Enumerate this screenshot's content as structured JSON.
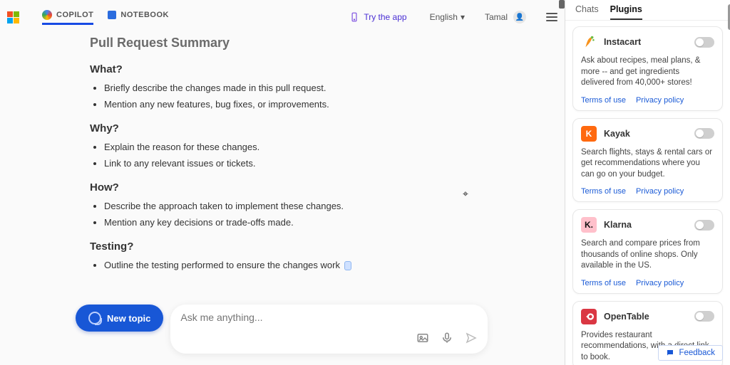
{
  "topbar": {
    "mode_copilot": "COPILOT",
    "mode_notebook": "NOTEBOOK",
    "try_app": "Try the app",
    "lang": "English",
    "user": "Tamal"
  },
  "doc": {
    "title": "Pull Request Summary",
    "sections": [
      {
        "heading": "What?",
        "items": [
          "Briefly describe the changes made in this pull request.",
          "Mention any new features, bug fixes, or improvements."
        ]
      },
      {
        "heading": "Why?",
        "items": [
          "Explain the reason for these changes.",
          "Link to any relevant issues or tickets."
        ]
      },
      {
        "heading": "How?",
        "items": [
          "Describe the approach taken to implement these changes.",
          "Mention any key decisions or trade-offs made."
        ]
      },
      {
        "heading": "Testing?",
        "items": [
          "Outline the testing performed to ensure the changes work"
        ]
      }
    ]
  },
  "composer": {
    "new_topic": "New topic",
    "placeholder": "Ask me anything..."
  },
  "side": {
    "tab_chats": "Chats",
    "tab_plugins": "Plugins",
    "tos": "Terms of use",
    "privacy": "Privacy policy",
    "plugins": [
      {
        "name": "Instacart",
        "desc": "Ask about recipes, meal plans, & more -- and get ingredients delivered from 40,000+ stores!"
      },
      {
        "name": "Kayak",
        "desc": "Search flights, stays & rental cars or get recommendations where you can go on your budget."
      },
      {
        "name": "Klarna",
        "desc": "Search and compare prices from thousands of online shops. Only available in the US."
      },
      {
        "name": "OpenTable",
        "desc": "Provides restaurant recommendations, with a direct link to book."
      }
    ]
  },
  "feedback": "Feedback"
}
